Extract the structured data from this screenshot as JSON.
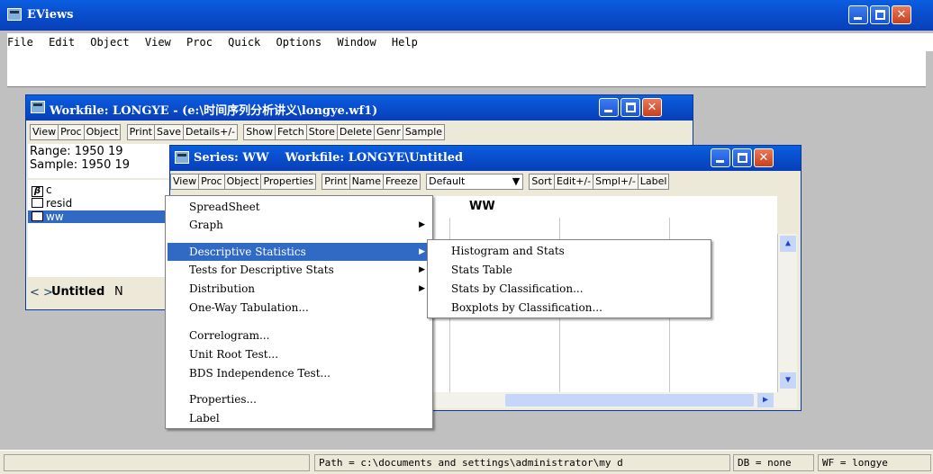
{
  "app": {
    "title": "EViews"
  },
  "menubar": [
    "File",
    "Edit",
    "Object",
    "View",
    "Proc",
    "Quick",
    "Options",
    "Window",
    "Help"
  ],
  "workfile": {
    "title": "Workfile: LONGYE - (e:\\时间序列分析讲义\\longye.wf1)",
    "toolbar": [
      "View",
      "Proc",
      "Object",
      "Print",
      "Save",
      "Details+/-",
      "Show",
      "Fetch",
      "Store",
      "Delete",
      "Genr",
      "Sample"
    ],
    "range_label": "Range:",
    "range_value": "1950 19",
    "sample_label": "Sample: 1950 19",
    "objects": [
      "c",
      "resid",
      "ww"
    ],
    "tab_untitled": "Untitled",
    "tab_next": "N"
  },
  "series": {
    "title": "Series: WW    Workfile: LONGYE\\Untitled",
    "toolbar": [
      "View",
      "Proc",
      "Object",
      "Properties",
      "Print",
      "Name",
      "Freeze"
    ],
    "dropdown_value": "Default",
    "toolbar2": [
      "Sort",
      "Edit+/-",
      "Smpl+/-",
      "Label"
    ],
    "column_header": "WW"
  },
  "view_menu": {
    "items": [
      "SpreadSheet",
      "Graph",
      "Descriptive Statistics",
      "Tests for Descriptive Stats",
      "Distribution",
      "One-Way Tabulation...",
      "Correlogram...",
      "Unit Root Test...",
      "BDS Independence Test...",
      "Properties...",
      "Label"
    ]
  },
  "submenu": {
    "items": [
      "Histogram and Stats",
      "Stats Table",
      "Stats by Classification...",
      "Boxplots by Classification..."
    ]
  },
  "statusbar": {
    "path": "Path = c:\\documents and settings\\administrator\\my d",
    "db": "DB = none",
    "wf": "WF = longye"
  },
  "colors": {
    "titlebar": "#0950d0",
    "highlight": "#316ac5",
    "close": "#c8401d"
  }
}
